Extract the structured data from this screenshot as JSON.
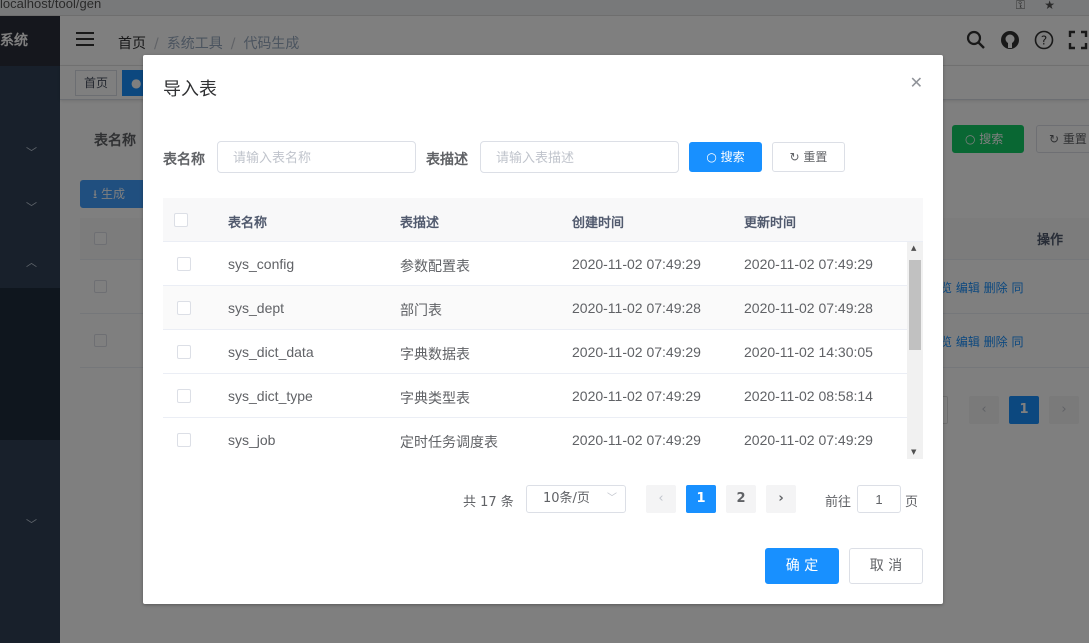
{
  "browser": {
    "url": "localhost/tool/gen"
  },
  "sidebar": {
    "logo_text": "系统"
  },
  "navbar": {
    "breadcrumb": [
      "首页",
      "系统工具",
      "代码生成"
    ],
    "icons": [
      "search-icon",
      "github-icon",
      "question-icon",
      "fullscreen-icon"
    ]
  },
  "tags": {
    "home": "首页"
  },
  "background": {
    "filter_label": "表名称",
    "generate_label": "生成",
    "search_label": "搜索",
    "reset_label": "重置",
    "operation_header": "操作",
    "row_actions": "览 编辑 删除 同",
    "page_current": "1"
  },
  "dialog": {
    "title": "导入表",
    "filters": {
      "table_name_label": "表名称",
      "table_name_placeholder": "请输入表名称",
      "table_desc_label": "表描述",
      "table_desc_placeholder": "请输入表描述",
      "search_label": "搜索",
      "reset_label": "重置"
    },
    "table": {
      "headers": [
        "表名称",
        "表描述",
        "创建时间",
        "更新时间"
      ],
      "rows": [
        {
          "name": "sys_config",
          "desc": "参数配置表",
          "created": "2020-11-02 07:49:29",
          "updated": "2020-11-02 07:49:29"
        },
        {
          "name": "sys_dept",
          "desc": "部门表",
          "created": "2020-11-02 07:49:28",
          "updated": "2020-11-02 07:49:28"
        },
        {
          "name": "sys_dict_data",
          "desc": "字典数据表",
          "created": "2020-11-02 07:49:29",
          "updated": "2020-11-02 14:30:05"
        },
        {
          "name": "sys_dict_type",
          "desc": "字典类型表",
          "created": "2020-11-02 07:49:29",
          "updated": "2020-11-02 08:58:14"
        },
        {
          "name": "sys_job",
          "desc": "定时任务调度表",
          "created": "2020-11-02 07:49:29",
          "updated": "2020-11-02 07:49:29"
        }
      ]
    },
    "pagination": {
      "total_text": "共 17 条",
      "page_size": "10条/页",
      "pages": [
        "1",
        "2"
      ],
      "current_page": "1",
      "goto_label": "前往",
      "goto_value": "1",
      "page_suffix": "页"
    },
    "confirm_label": "确 定",
    "cancel_label": "取 消"
  },
  "colors": {
    "primary": "#1890ff",
    "sidebar": "#304156",
    "success": "#13ce66"
  }
}
